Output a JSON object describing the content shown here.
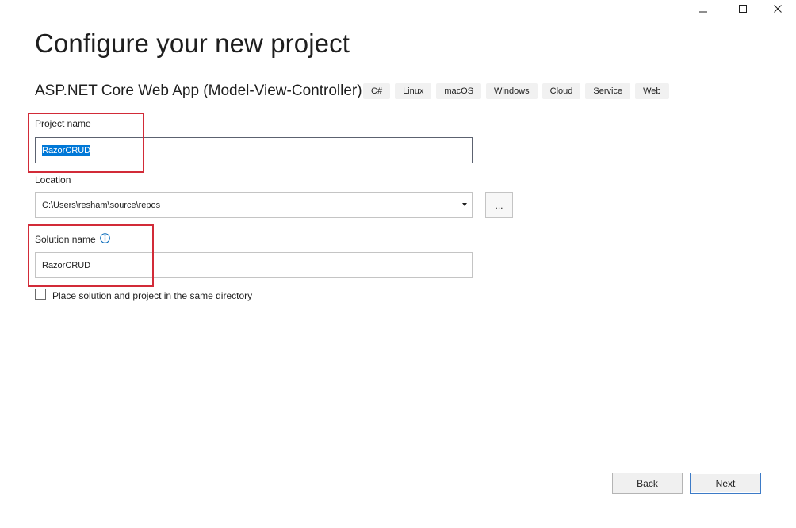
{
  "header": {
    "title": "Configure your new project",
    "template_name": "ASP.NET Core Web App (Model-View-Controller)",
    "tags": [
      "C#",
      "Linux",
      "macOS",
      "Windows",
      "Cloud",
      "Service",
      "Web"
    ]
  },
  "form": {
    "project_name": {
      "label": "Project name",
      "value": "RazorCRUD"
    },
    "location": {
      "label": "Location",
      "value": "C:\\Users\\resham\\source\\repos",
      "browse_label": "..."
    },
    "solution_name": {
      "label": "Solution name",
      "value": "RazorCRUD"
    },
    "same_directory": {
      "label": "Place solution and project in the same directory",
      "checked": false
    }
  },
  "footer": {
    "back_label": "Back",
    "next_label": "Next"
  },
  "colors": {
    "highlight": "#d22b38",
    "selection": "#0078d7",
    "info_icon": "#0066b8",
    "primary_border": "#3d7bc7"
  },
  "icons": {
    "window_controls": [
      "minimize-icon",
      "maximize-icon",
      "close-icon"
    ],
    "info": "info-icon",
    "dropdown": "chevron-down-icon"
  }
}
